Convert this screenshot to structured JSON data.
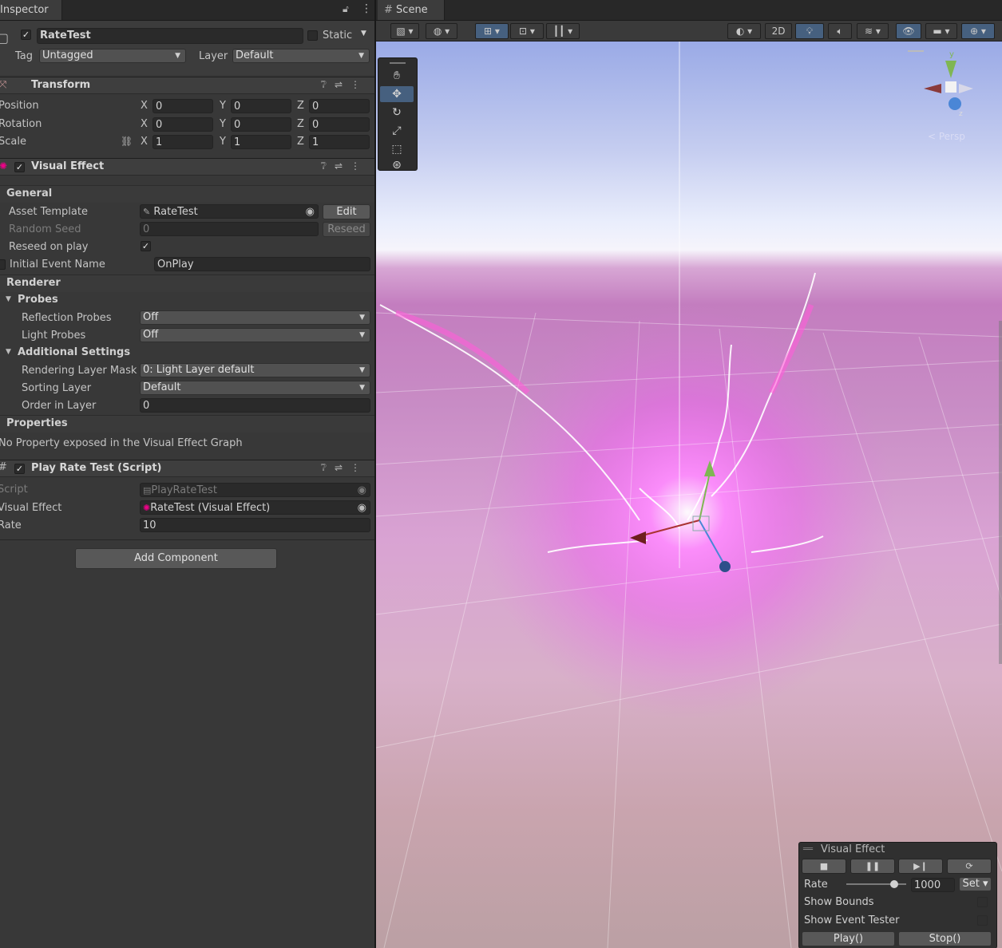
{
  "inspector": {
    "tab_label": "Inspector",
    "object": {
      "name": "RateTest",
      "active": true,
      "static_label": "Static",
      "tag_label": "Tag",
      "tag_value": "Untagged",
      "layer_label": "Layer",
      "layer_value": "Default"
    },
    "transform": {
      "title": "Transform",
      "rows": [
        {
          "label": "Position",
          "x": "0",
          "y": "0",
          "z": "0"
        },
        {
          "label": "Rotation",
          "x": "0",
          "y": "0",
          "z": "0"
        },
        {
          "label": "Scale",
          "x": "1",
          "y": "1",
          "z": "1"
        }
      ],
      "axis_x": "X",
      "axis_y": "Y",
      "axis_z": "Z"
    },
    "visual_effect": {
      "title": "Visual Effect",
      "general_label": "General",
      "asset_template_label": "Asset Template",
      "asset_template_value": "RateTest",
      "edit_button": "Edit",
      "random_seed_label": "Random Seed",
      "random_seed_value": "0",
      "reseed_button": "Reseed",
      "reseed_on_play_label": "Reseed on play",
      "initial_event_label": "Initial Event Name",
      "initial_event_value": "OnPlay",
      "renderer_label": "Renderer",
      "probes_label": "Probes",
      "reflection_probes_label": "Reflection Probes",
      "reflection_probes_value": "Off",
      "light_probes_label": "Light Probes",
      "light_probes_value": "Off",
      "additional_settings_label": "Additional Settings",
      "rendering_layer_mask_label": "Rendering Layer Mask",
      "rendering_layer_mask_value": "0: Light Layer default",
      "sorting_layer_label": "Sorting Layer",
      "sorting_layer_value": "Default",
      "order_in_layer_label": "Order in Layer",
      "order_in_layer_value": "0",
      "properties_label": "Properties",
      "no_property_text": "No Property exposed in the Visual Effect Graph"
    },
    "play_rate_test": {
      "title": "Play Rate Test (Script)",
      "script_label": "Script",
      "script_value": "PlayRateTest",
      "visual_effect_label": "Visual Effect",
      "visual_effect_value": "RateTest (Visual Effect)",
      "rate_label": "Rate",
      "rate_value": "10"
    },
    "add_component_button": "Add Component"
  },
  "scene": {
    "tab_label": "Scene",
    "toolbar": {
      "mode_2d": "2D"
    },
    "gizmo": {
      "y": "y",
      "z": "z",
      "persp": "< Persp"
    },
    "vfx_panel": {
      "title": "Visual Effect",
      "rate_label": "Rate",
      "rate_value": "1000",
      "rate_fraction": 0.8,
      "set_button": "Set ▾",
      "show_bounds_label": "Show Bounds",
      "show_event_tester_label": "Show Event Tester",
      "play_button": "Play()",
      "stop_button": "Stop()"
    }
  }
}
